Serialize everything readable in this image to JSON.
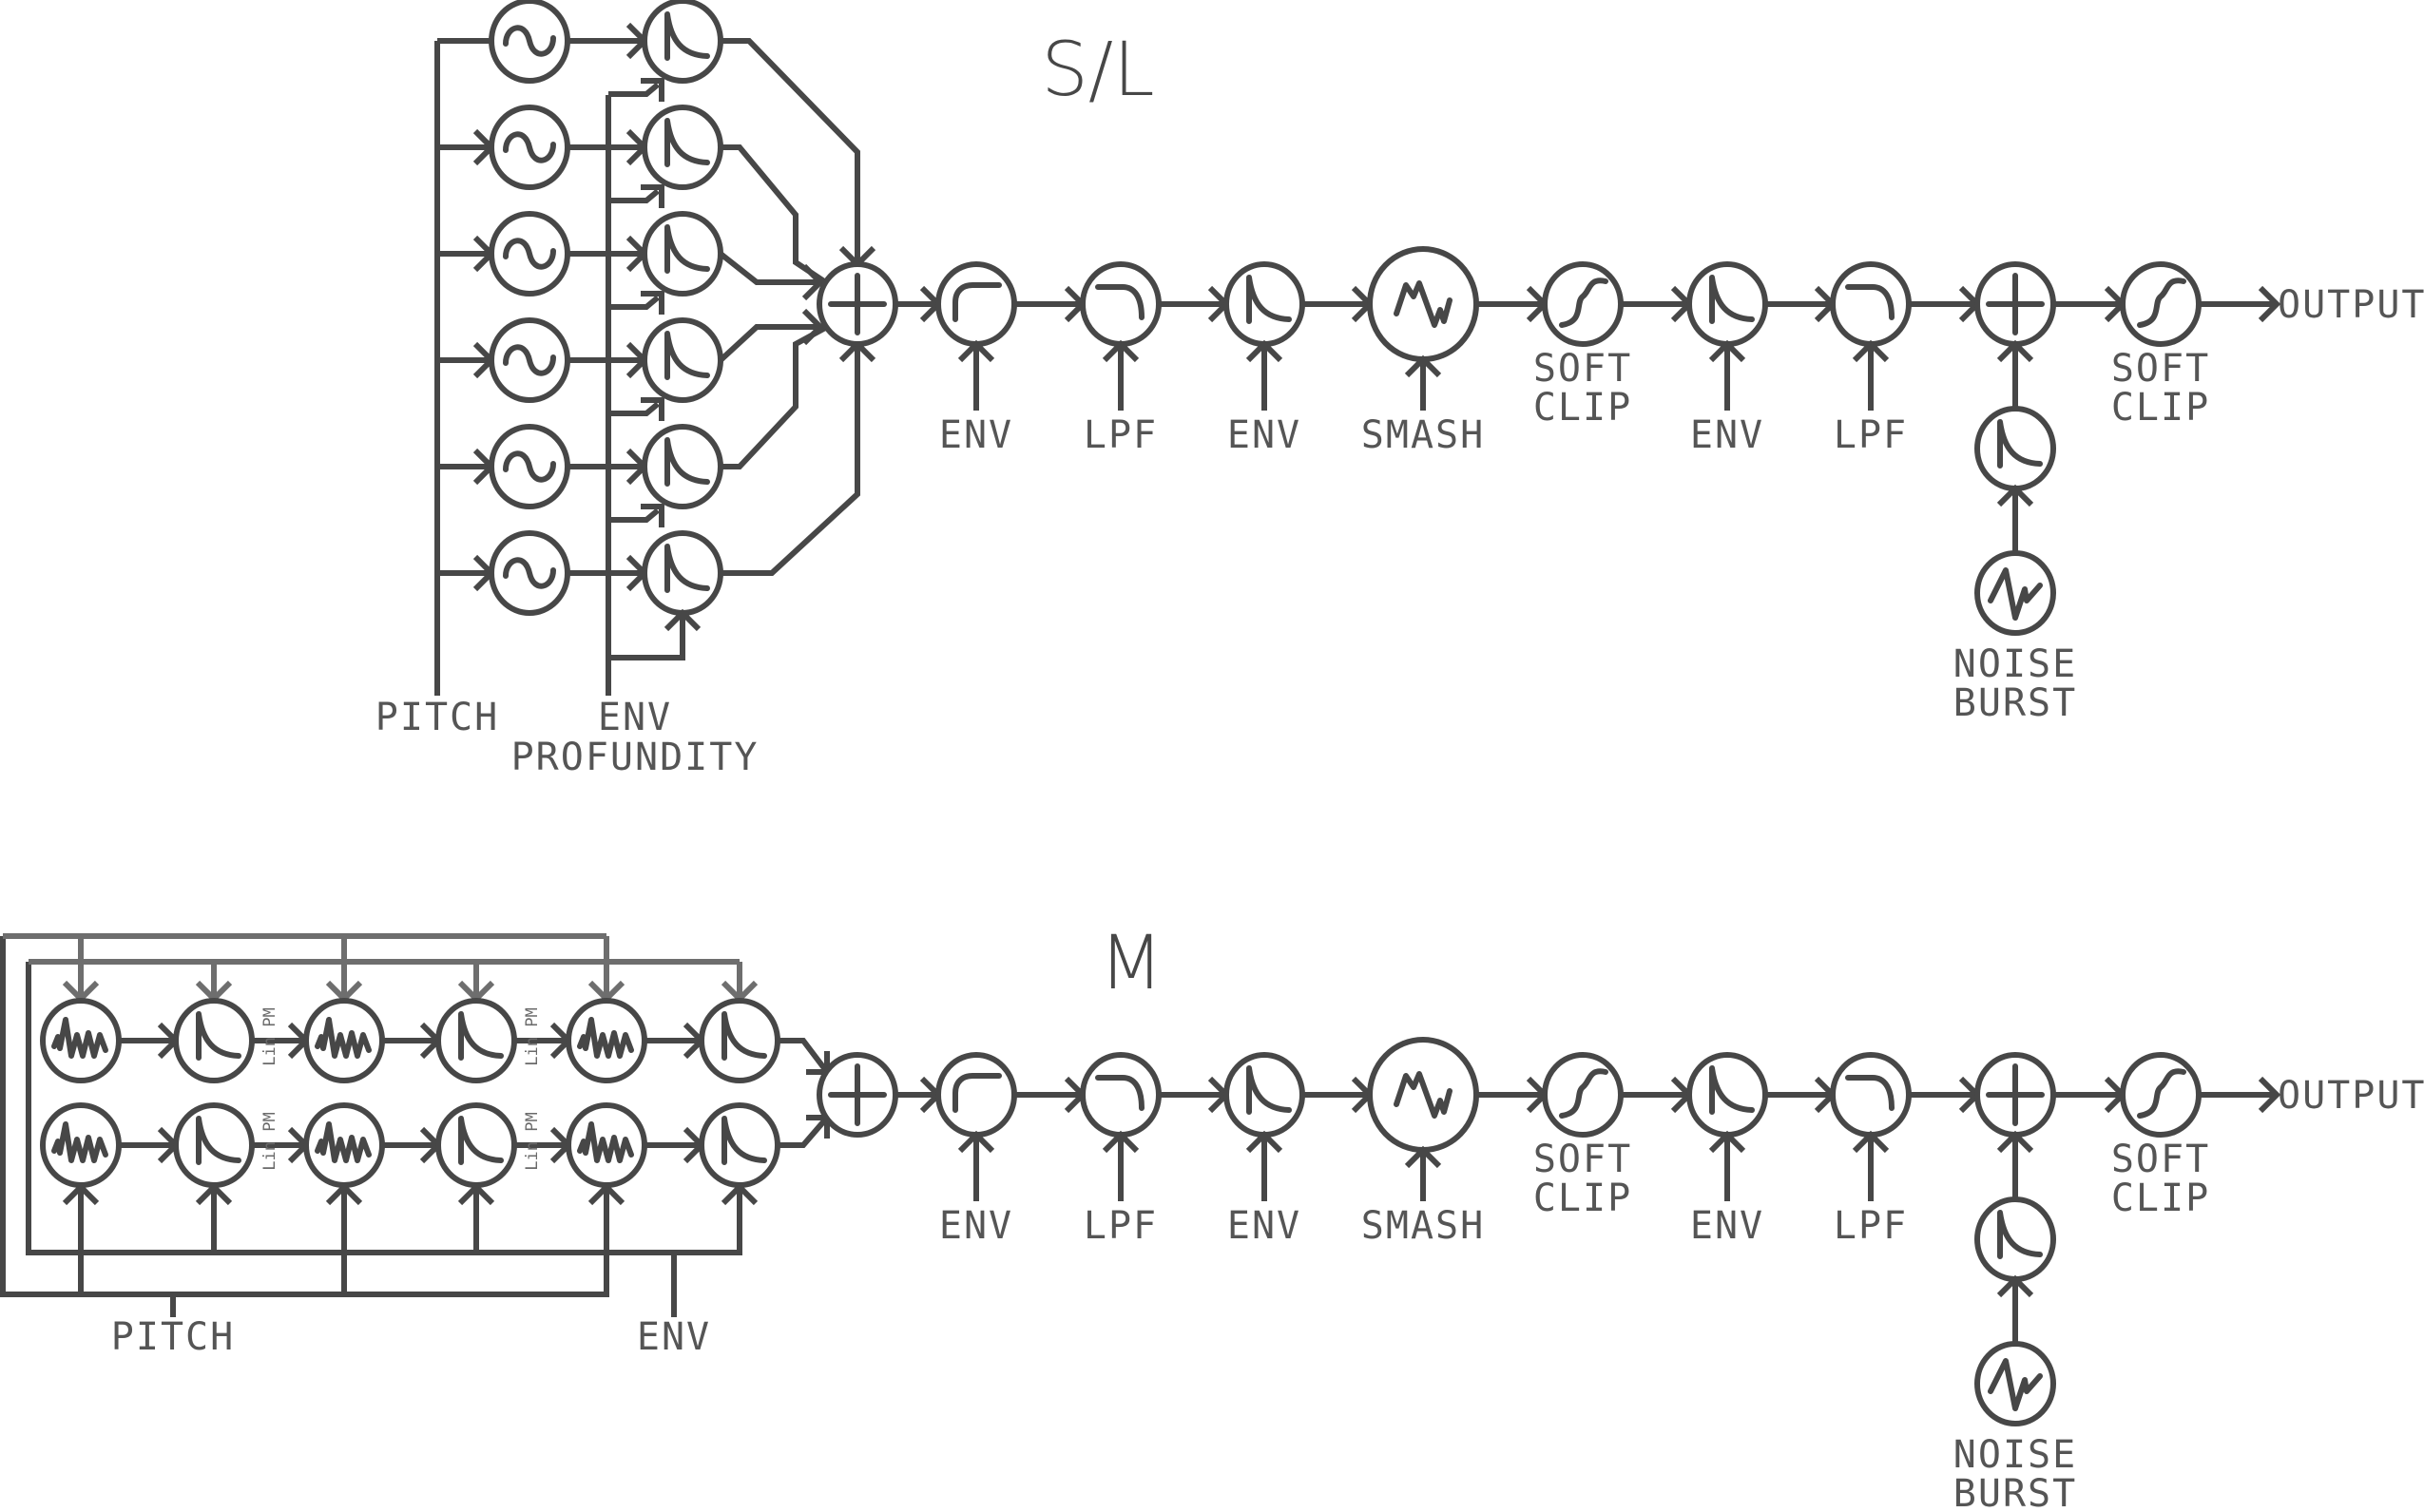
{
  "sections": [
    {
      "id": "sl",
      "title": "S/L",
      "inputs": {
        "pitch_label": "PITCH",
        "env_label": "ENV",
        "env_label2": "PROFUNDITY"
      },
      "voice_count": 6,
      "voice_osc_type": "sine",
      "voice_env_type": "env",
      "chain": [
        {
          "type": "sum"
        },
        {
          "type": "hpf",
          "label": "ENV"
        },
        {
          "type": "lpf",
          "label": "LPF"
        },
        {
          "type": "env",
          "label": "ENV"
        },
        {
          "type": "smash",
          "label": "SMASH"
        },
        {
          "type": "softclip",
          "label": "SOFT",
          "label2": "CLIP"
        },
        {
          "type": "env",
          "label": "ENV"
        },
        {
          "type": "lpf",
          "label": "LPF"
        },
        {
          "type": "sum"
        },
        {
          "type": "softclip",
          "label": "SOFT",
          "label2": "CLIP"
        }
      ],
      "noise": {
        "label": "NOISE",
        "label2": "BURST"
      },
      "output_label": "OUTPUT"
    },
    {
      "id": "m",
      "title": "M",
      "inputs": {
        "pitch_label": "PITCH",
        "env_label": "ENV"
      },
      "grid_rows": 2,
      "grid_columns": [
        "noise",
        "env",
        "noise",
        "env",
        "noise",
        "env"
      ],
      "pm_label": "Lin PM",
      "chain": [
        {
          "type": "sum"
        },
        {
          "type": "hpf",
          "label": "ENV"
        },
        {
          "type": "lpf",
          "label": "LPF"
        },
        {
          "type": "env",
          "label": "ENV"
        },
        {
          "type": "smash",
          "label": "SMASH"
        },
        {
          "type": "softclip",
          "label": "SOFT",
          "label2": "CLIP"
        },
        {
          "type": "env",
          "label": "ENV"
        },
        {
          "type": "lpf",
          "label": "LPF"
        },
        {
          "type": "sum"
        },
        {
          "type": "softclip",
          "label": "SOFT",
          "label2": "CLIP"
        }
      ],
      "noise": {
        "label": "NOISE",
        "label2": "BURST"
      },
      "output_label": "OUTPUT"
    }
  ],
  "colors": {
    "stroke": "#474747",
    "bus_light": "#6e6e6e",
    "text": "#555555",
    "background": "#ffffff"
  }
}
